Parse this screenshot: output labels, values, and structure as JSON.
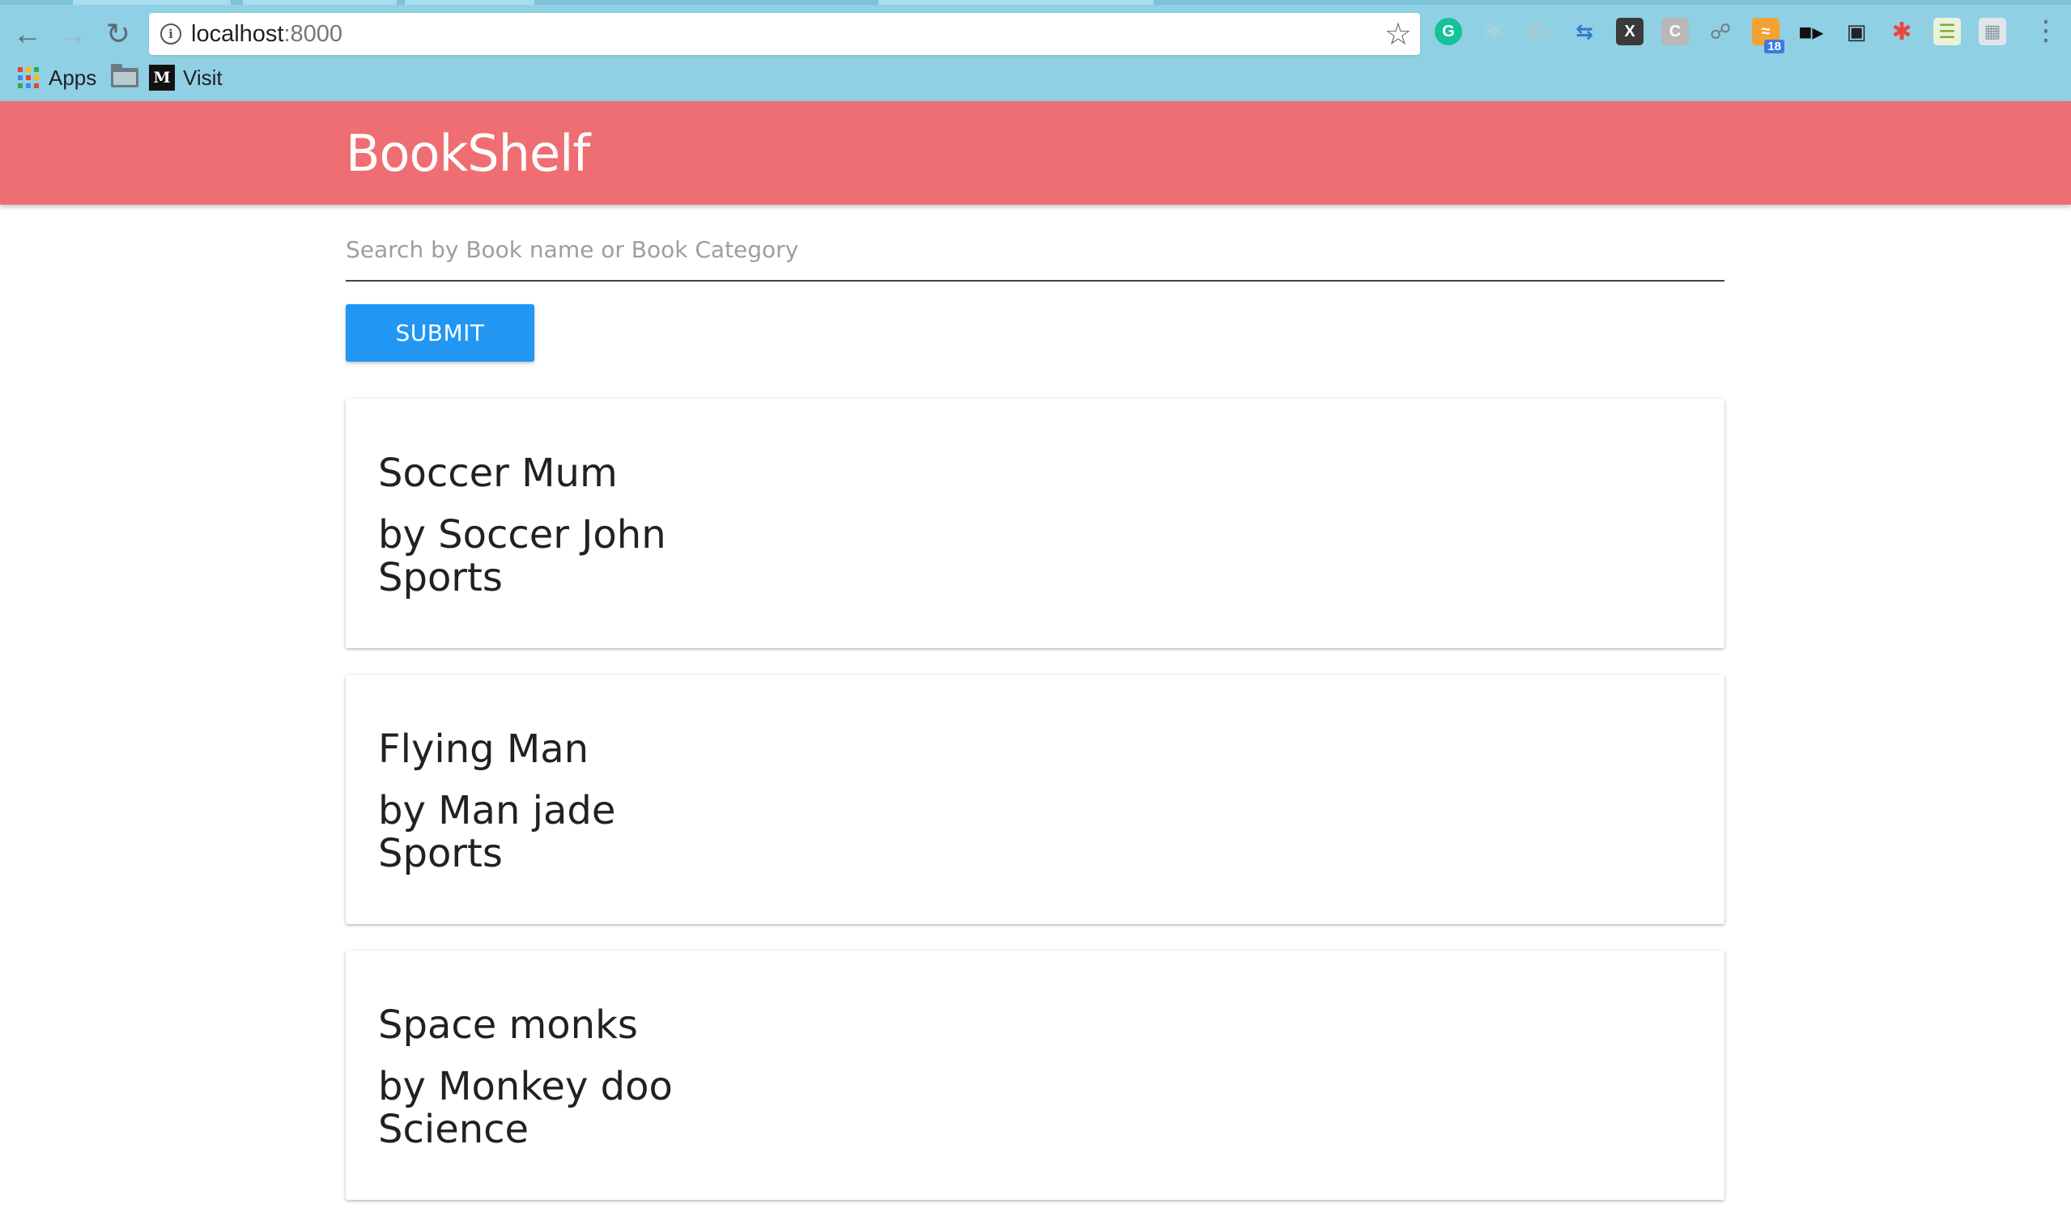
{
  "browser": {
    "url_host": "localhost",
    "url_port": ":8000",
    "extension_badge": "18",
    "bookmarks": {
      "apps_label": "Apps",
      "visit_label": "Visit",
      "medium_glyph": "M"
    }
  },
  "app": {
    "title": "BookShelf",
    "search": {
      "placeholder": "Search by Book name or Book Category",
      "value": ""
    },
    "submit_label": "SUBMIT",
    "books": [
      {
        "title": "Soccer Mum",
        "author": "by Soccer John",
        "category": "Sports"
      },
      {
        "title": "Flying Man",
        "author": "by Man jade",
        "category": "Sports"
      },
      {
        "title": "Space monks",
        "author": "by Monkey doo",
        "category": "Science"
      }
    ]
  },
  "colors": {
    "browser_chrome": "#8fd0e5",
    "header": "#ef6e73",
    "submit_button": "#2196f3"
  }
}
